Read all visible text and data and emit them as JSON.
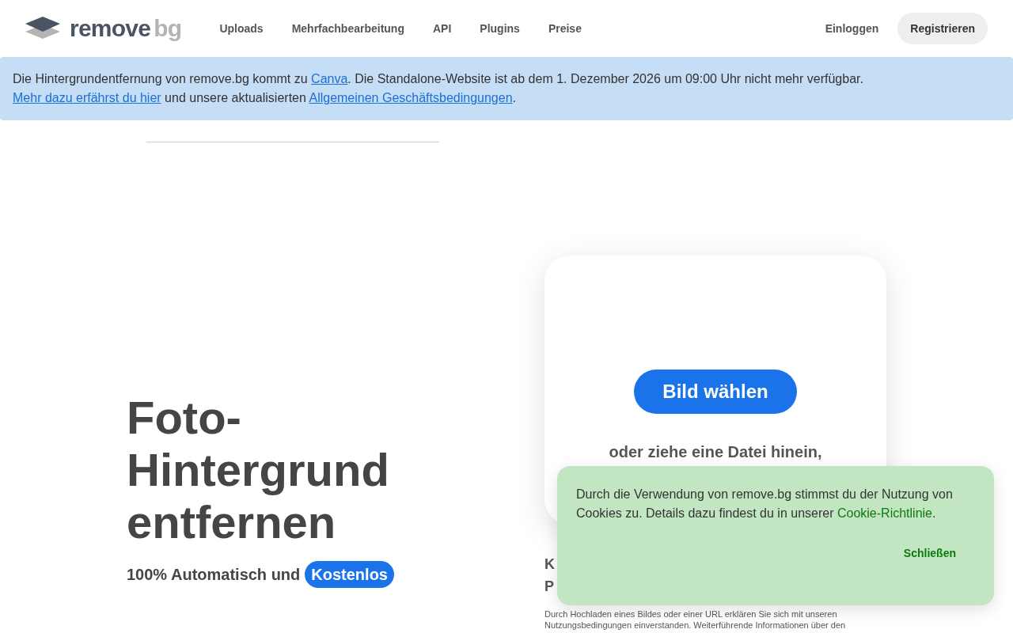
{
  "nav": {
    "logo_word": "remove",
    "logo_suffix": "bg",
    "links": [
      "Uploads",
      "Mehrfachbearbeitung",
      "API",
      "Plugins",
      "Preise"
    ],
    "login": "Einloggen",
    "register": "Registrieren"
  },
  "banner": {
    "segments": [
      {
        "text": "Die Hintergrundentfernung von remove.bg kommt zu ",
        "link": false
      },
      {
        "text": "Canva",
        "link": true
      },
      {
        "text": ". Die Standalone-Website ist ab dem 1. Dezember 2026 um 09:00 Uhr nicht mehr verfügbar. ",
        "link": false
      },
      {
        "text": "Mehr dazu erfährst du hier",
        "link": true
      },
      {
        "text": " und unsere aktualisierten ",
        "link": false
      },
      {
        "text": "Allgemeinen Geschäftsbedingungen",
        "link": true
      },
      {
        "text": ".",
        "link": false
      }
    ]
  },
  "hero": {
    "title_lines": [
      "Foto-",
      "Hintergrund",
      "entfernen"
    ],
    "subtitle": "100% Automatisch und",
    "badge": "Kostenlos"
  },
  "upload_card": {
    "button": "Bild wählen",
    "drop_hint": "oder ziehe eine Datei hinein,"
  },
  "below_card": {
    "lines": [
      "K",
      "P"
    ],
    "disclaimer_lines": [
      "Durch Hochladen eines Bildes oder einer URL erklären Sie sich mit unseren",
      "Nutzungsbedingungen einverstanden. Weiterführende Informationen über den"
    ]
  },
  "cookie": {
    "text": "Durch die Verwendung von remove.bg stimmst du der Nutzung von Cookies zu. Details dazu findest du in unserer ",
    "link": "Cookie-Richtlinie",
    "after": ".",
    "close": "Schließen"
  }
}
